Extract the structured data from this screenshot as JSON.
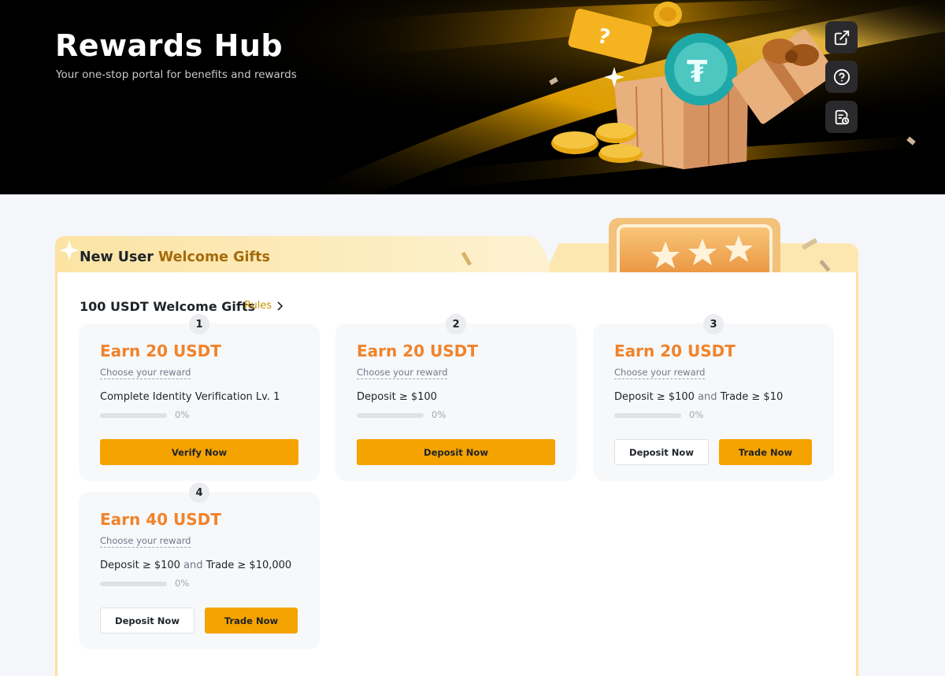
{
  "hero": {
    "title": "Rewards Hub",
    "subtitle": "Your one-stop portal for benefits and rewards",
    "side_buttons": [
      {
        "icon": "external-link-icon"
      },
      {
        "icon": "help-circle-icon"
      },
      {
        "icon": "reward-history-icon"
      }
    ]
  },
  "welcome": {
    "title_prefix": "New User ",
    "title_highlight": "Welcome Gifts",
    "section_title": "100 USDT Welcome Gifts",
    "rules_label": "Rules",
    "cards": [
      {
        "step": "1",
        "earn": "Earn 20 USDT",
        "choose": "Choose your reward",
        "task_a": "Complete Identity Verification Lv. 1",
        "and": "",
        "task_b": "",
        "progress": 0,
        "pct": "0%",
        "buttons": [
          "Verify Now"
        ]
      },
      {
        "step": "2",
        "earn": "Earn 20 USDT",
        "choose": "Choose your reward",
        "task_a": "Deposit ≥ $100",
        "and": "",
        "task_b": "",
        "progress": 0,
        "pct": "0%",
        "buttons": [
          "Deposit Now"
        ]
      },
      {
        "step": "3",
        "earn": "Earn 20 USDT",
        "choose": "Choose your reward",
        "task_a": "Deposit ≥ $100",
        "and": "and",
        "task_b": "Trade ≥ $10",
        "progress": 0,
        "pct": "0%",
        "buttons": [
          "Deposit Now",
          "Trade Now"
        ]
      },
      {
        "step": "4",
        "earn": "Earn 40 USDT",
        "choose": "Choose your reward",
        "task_a": "Deposit ≥ $100",
        "and": "and",
        "task_b": "Trade ≥ $10,000",
        "progress": 0,
        "pct": "0%",
        "buttons": [
          "Deposit Now",
          "Trade Now"
        ]
      }
    ]
  },
  "colors": {
    "accent": "#f5a300",
    "earn": "#f0832b",
    "gold_text": "#a46b0b",
    "link": "#c99400"
  }
}
